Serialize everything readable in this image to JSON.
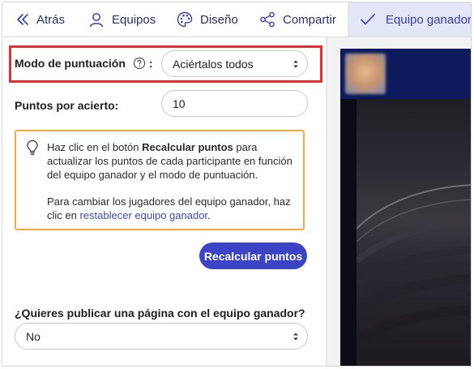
{
  "tabs": {
    "back": "Atrás",
    "teams": "Equipos",
    "design": "Diseño",
    "share": "Compartir",
    "winner": "Equipo ganador"
  },
  "scoring": {
    "label": "Modo de puntuación",
    "colon": ":",
    "selected": "Aciértalos todos"
  },
  "points": {
    "label": "Puntos por acierto:",
    "value": "10"
  },
  "notice": {
    "p1_pre": "Haz clic en el botón ",
    "p1_bold": "Recalcular puntos",
    "p1_post": " para actualizar los puntos de cada participante en función del equipo ganador y el modo de puntuación.",
    "p2_pre": "Para cambiar los jugadores del equipo ganador, haz clic en ",
    "p2_link": "restablecer equipo ganador",
    "p2_post": "."
  },
  "recalc_button": "Recalcular puntos",
  "publish": {
    "question": "¿Quieres publicar una página con el equipo ganador?",
    "selected": "No"
  },
  "colors": {
    "accent": "#3a44c4",
    "active_tab_bg": "#e3e6f5",
    "highlight_border": "#e53030",
    "notice_border": "#f3a93c"
  }
}
